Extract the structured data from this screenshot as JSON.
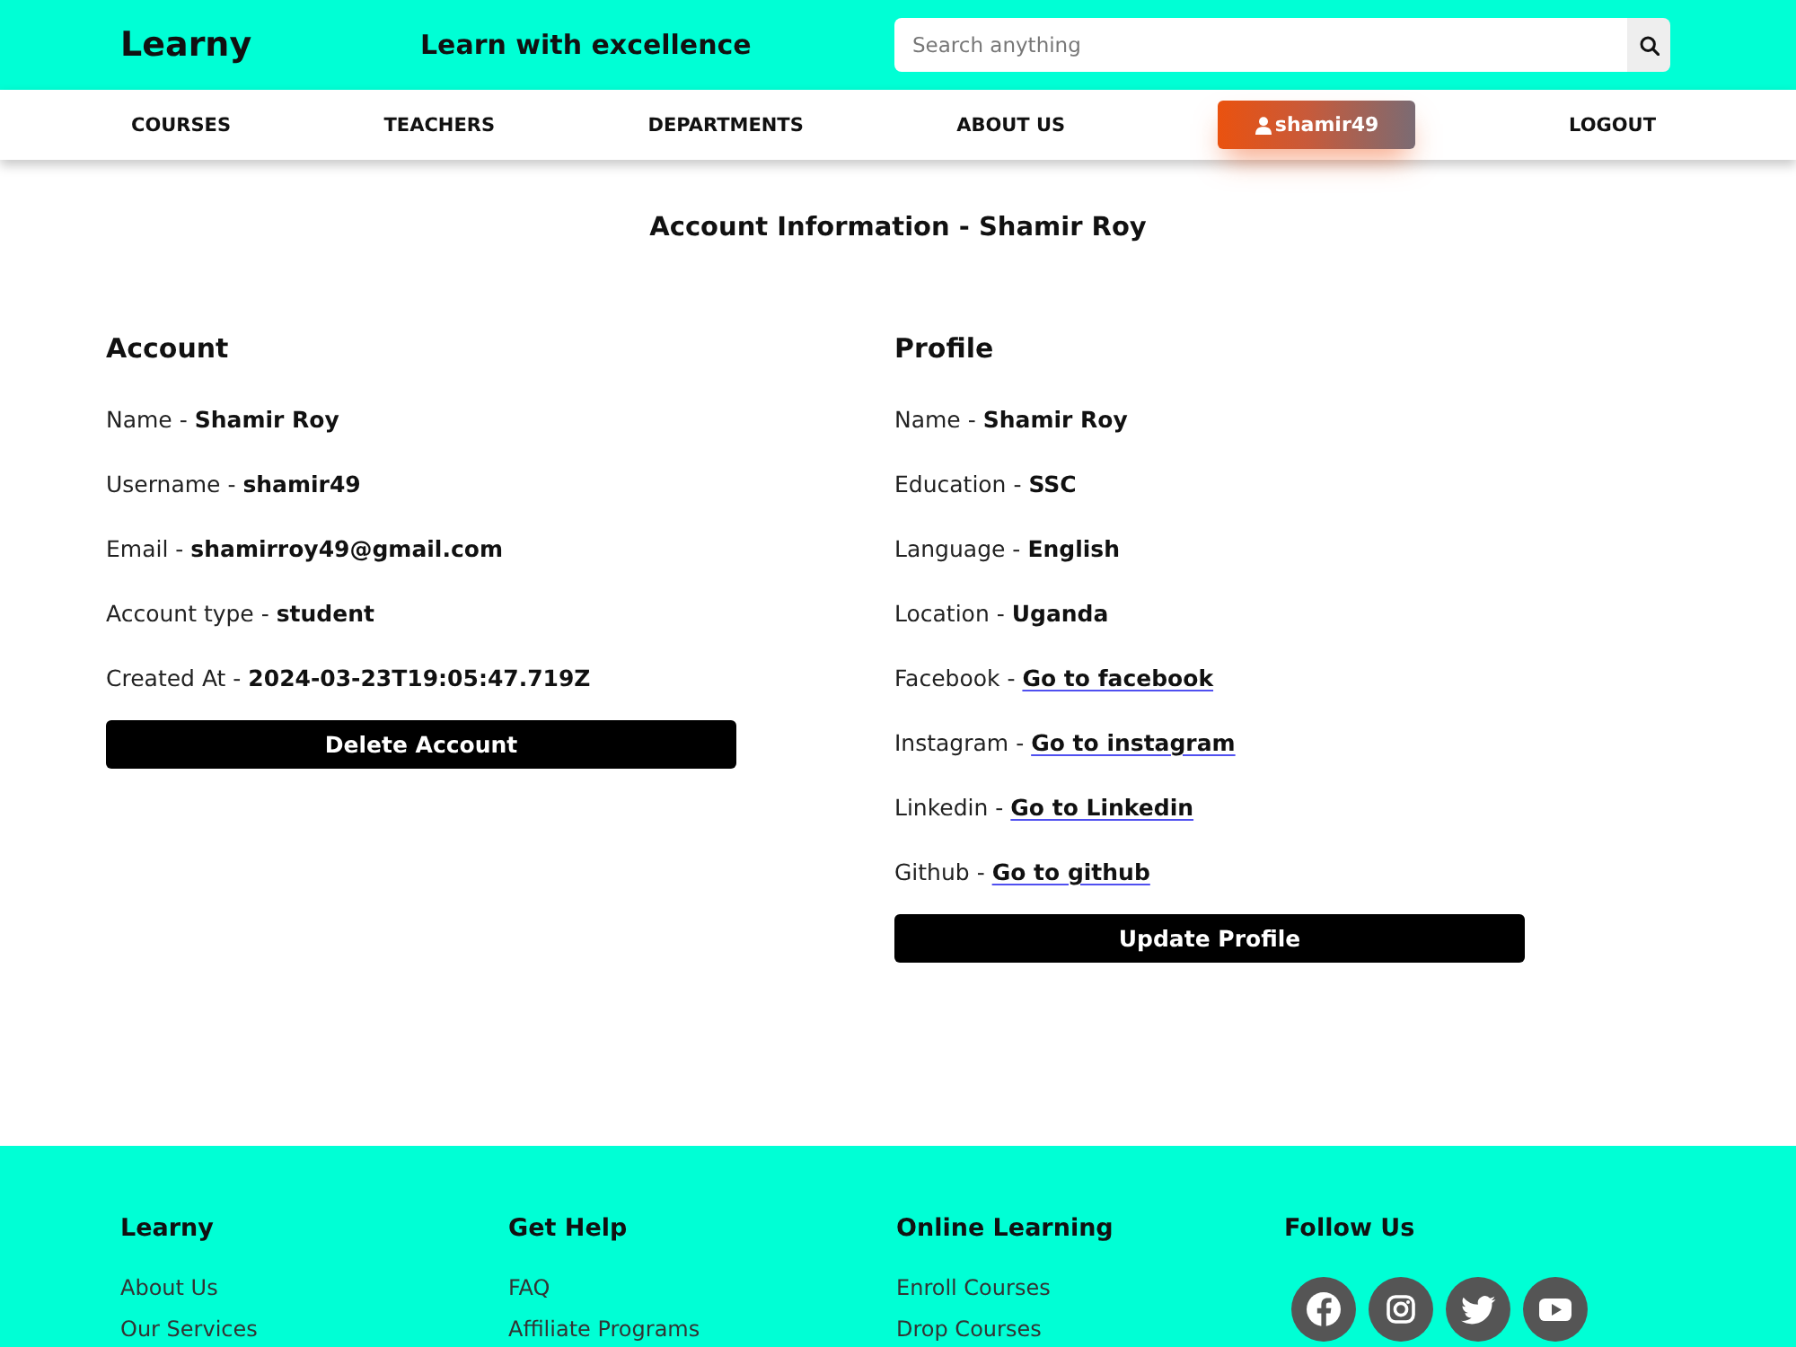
{
  "header": {
    "logo": "Learny",
    "tagline": "Learn with excellence",
    "search": {
      "placeholder": "Search anything"
    }
  },
  "nav": {
    "items": [
      {
        "label": "COURSES",
        "kind": "link"
      },
      {
        "label": "TEACHERS",
        "kind": "link"
      },
      {
        "label": "DEPARTMENTS",
        "kind": "link"
      },
      {
        "label": "ABOUT US",
        "kind": "link"
      },
      {
        "label": "shamir49",
        "kind": "user"
      },
      {
        "label": "LOGOUT",
        "kind": "link"
      }
    ]
  },
  "page_title": "Account Information - Shamir Roy",
  "sections": [
    {
      "heading": "Account",
      "fields": [
        {
          "kind": "text",
          "label": "Name -",
          "value": "Shamir Roy"
        },
        {
          "kind": "text",
          "label": "Username -",
          "value": "shamir49"
        },
        {
          "kind": "text",
          "label": "Email -",
          "value": "shamirroy49@gmail.com"
        },
        {
          "kind": "text",
          "label": "Account type -",
          "value": "student"
        },
        {
          "kind": "text",
          "label": "Created At -",
          "value": "2024-03-23T19:05:47.719Z"
        }
      ],
      "button": "Delete Account"
    },
    {
      "heading": "Profile",
      "fields": [
        {
          "kind": "text",
          "label": "Name -",
          "value": "Shamir Roy"
        },
        {
          "kind": "text",
          "label": "Education -",
          "value": "SSC"
        },
        {
          "kind": "text",
          "label": "Language -",
          "value": "English"
        },
        {
          "kind": "text",
          "label": "Location -",
          "value": "Uganda"
        },
        {
          "kind": "link",
          "label": "Facebook -",
          "value": "Go to facebook"
        },
        {
          "kind": "link",
          "label": "Instagram -",
          "value": "Go to instagram"
        },
        {
          "kind": "link",
          "label": "Linkedin -",
          "value": "Go to Linkedin"
        },
        {
          "kind": "link",
          "label": "Github -",
          "value": "Go to github"
        }
      ],
      "button": "Update Profile"
    }
  ],
  "footer": {
    "columns": [
      {
        "heading": "Learny",
        "links": [
          "About Us",
          "Our Services"
        ]
      },
      {
        "heading": "Get Help",
        "links": [
          "FAQ",
          "Affiliate Programs"
        ]
      },
      {
        "heading": "Online Learning",
        "links": [
          "Enroll Courses",
          "Drop Courses"
        ]
      },
      {
        "heading": "Follow Us",
        "social": [
          {
            "kind": "facebook"
          },
          {
            "kind": "instagram"
          },
          {
            "kind": "twitter"
          },
          {
            "kind": "youtube"
          }
        ]
      }
    ]
  }
}
